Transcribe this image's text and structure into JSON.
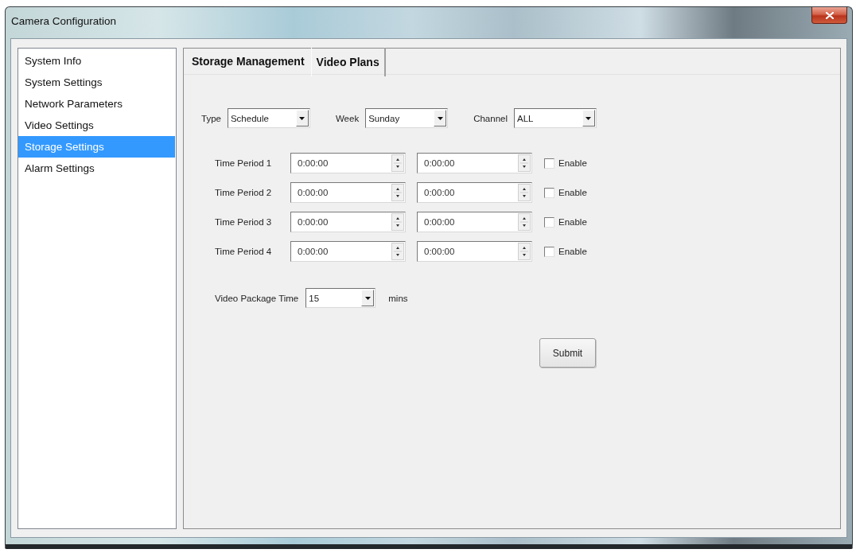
{
  "window": {
    "title": "Camera Configuration"
  },
  "sidebar": {
    "items": [
      {
        "label": "System Info",
        "selected": false
      },
      {
        "label": "System Settings",
        "selected": false
      },
      {
        "label": "Network Parameters",
        "selected": false
      },
      {
        "label": "Video Settings",
        "selected": false
      },
      {
        "label": "Storage Settings",
        "selected": true
      },
      {
        "label": "Alarm Settings",
        "selected": false
      }
    ]
  },
  "tabs": [
    {
      "label": "Storage Management",
      "selected": false
    },
    {
      "label": "Video Plans",
      "selected": true
    }
  ],
  "filters": [
    {
      "label": "Type",
      "value": "Schedule"
    },
    {
      "label": "Week",
      "value": "Sunday"
    },
    {
      "label": "Channel",
      "value": "ALL"
    }
  ],
  "time_periods": [
    {
      "label": "Time Period 1",
      "start": "0:00:00",
      "end": "0:00:00",
      "enable_label": "Enable",
      "checked": false
    },
    {
      "label": "Time Period 2",
      "start": "0:00:00",
      "end": "0:00:00",
      "enable_label": "Enable",
      "checked": false
    },
    {
      "label": "Time Period 3",
      "start": "0:00:00",
      "end": "0:00:00",
      "enable_label": "Enable",
      "checked": false
    },
    {
      "label": "Time Period 4",
      "start": "0:00:00",
      "end": "0:00:00",
      "enable_label": "Enable",
      "checked": false
    }
  ],
  "package_time": {
    "label": "Video Package Time",
    "value": "15",
    "unit": "mins"
  },
  "buttons": [
    "Submit"
  ]
}
